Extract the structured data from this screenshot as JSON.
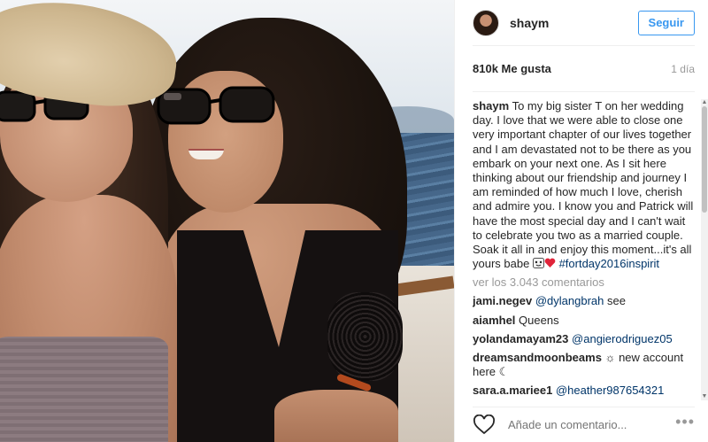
{
  "post": {
    "username": "shaym",
    "follow_label": "Seguir",
    "likes": "810k Me gusta",
    "time": "1 día",
    "caption_username": "shaym",
    "caption_text": " To my big sister T on her wedding day. I love that we were able to close one very important chapter of our lives together and I am devastated not to be there as you embark on your next one. As I sit here thinking about our friendship and journey I am reminded of how much I love, cherish and admire you. I know you and Patrick will have the most special day and I can't wait to celebrate you two as a married couple. Soak it all in and enjoy this moment...it's all yours babe ",
    "caption_hashtag": "#fortday2016inspirit",
    "view_all": "ver los 3.043 comentarios",
    "comments": [
      {
        "user": "jami.negev",
        "mention": "@dylangbrah",
        "text": " see"
      },
      {
        "user": "aiamhel",
        "mention": "",
        "text": " Queens"
      },
      {
        "user": "yolandamayam23",
        "mention": "@angierodriguez05",
        "text": ""
      },
      {
        "user": "dreamsandmoonbeams",
        "mention": "",
        "text": " ☼ new account here ☾"
      },
      {
        "user": "sara.a.mariee1",
        "mention": "@heather987654321",
        "text": ""
      }
    ],
    "add_comment_placeholder": "Añade un comentario...",
    "more_label": "•••"
  },
  "colors": {
    "accent": "#3897f0",
    "mention": "#003569",
    "muted": "#999999"
  },
  "icons": [
    "heart-outline-icon",
    "more-options-icon",
    "face-emoji-icon",
    "heart-emoji-icon"
  ]
}
